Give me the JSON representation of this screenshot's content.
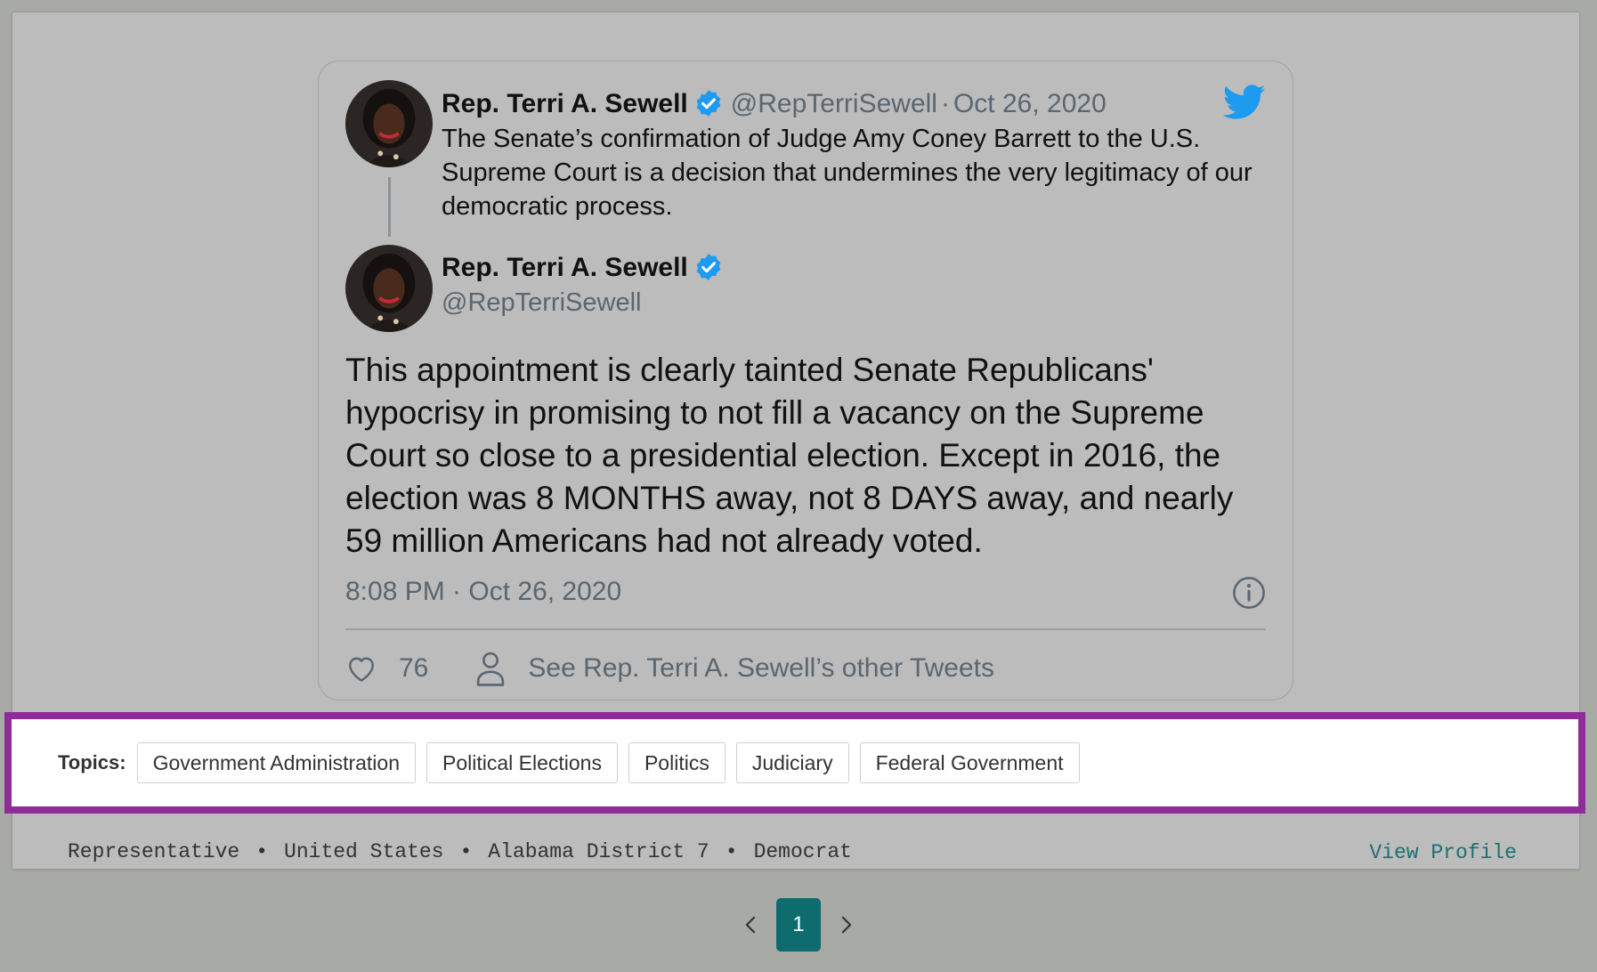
{
  "tweet": {
    "quoted": {
      "author_name": "Rep. Terri A. Sewell",
      "handle": "@RepTerriSewell",
      "separator": "·",
      "date": "Oct 26, 2020",
      "text": "The Senate’s confirmation of Judge Amy Coney Barrett to the U.S. Supreme Court is a decision that undermines the very legitimacy of our democratic process."
    },
    "main": {
      "author_name": "Rep. Terri A. Sewell",
      "handle": "@RepTerriSewell",
      "text": "This appointment is clearly tainted Senate Republicans' hypocrisy in promising to not fill a vacancy on the Supreme Court so close to a presidential election. Except in 2016, the election was 8 MONTHS away, not 8 DAYS away, and nearly 59 million Americans had not already voted.",
      "timestamp": "8:08 PM · Oct 26, 2020"
    },
    "like_count": "76",
    "other_tweets_link": "See Rep. Terri A. Sewell’s other Tweets",
    "icons": {
      "verified": "verified-badge-icon",
      "logo": "twitter-bird-icon",
      "info": "info-icon",
      "like": "heart-icon",
      "profile": "person-icon"
    },
    "colors": {
      "verified_blue": "#1d9bf0",
      "twitter_blue": "#1d9bf0",
      "muted_text": "#5a6670"
    }
  },
  "topics": {
    "label": "Topics:",
    "tags": [
      "Government Administration",
      "Political Elections",
      "Politics",
      "Judiciary",
      "Federal Government"
    ],
    "highlight_color": "#8e2c9a"
  },
  "meta": {
    "role": "Representative",
    "country": "United States",
    "district": "Alabama District 7",
    "party": "Democrat",
    "bullet": "•",
    "view_profile": "View Profile"
  },
  "pagination": {
    "current_page": "1",
    "prev_icon": "chevron-left-icon",
    "next_icon": "chevron-right-icon",
    "accent": "#0e6b6e"
  }
}
